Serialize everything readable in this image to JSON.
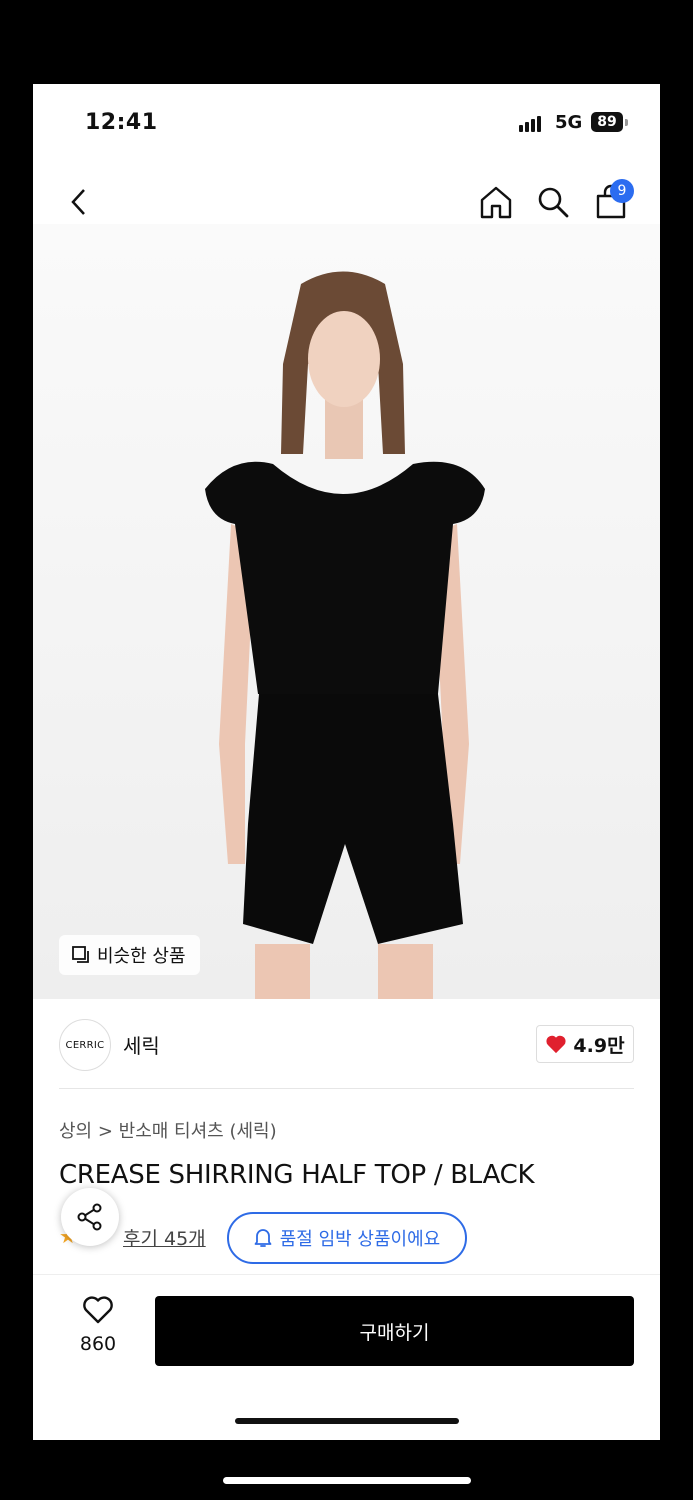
{
  "status_bar": {
    "time": "12:41",
    "network": "5G",
    "battery": "89"
  },
  "nav": {
    "cart_count": "9"
  },
  "hero": {
    "similar_label": "비슷한 상품"
  },
  "brand": {
    "logo_text": "CERRIC",
    "name": "세릭",
    "likes": "4.9만"
  },
  "product": {
    "breadcrumb": "상의 > 반소매 티셔츠 (세릭)",
    "title": "CREASE SHIRRING HALF TOP / BLACK",
    "reviews": "후기 45개",
    "stock_alert": "품절 임박 상품이에요"
  },
  "bottom": {
    "wish_count": "860",
    "buy_label": "구매하기"
  },
  "colors": {
    "accent_blue": "#2e6be6",
    "heart_red": "#e0202e",
    "buy_button": "#000000"
  }
}
